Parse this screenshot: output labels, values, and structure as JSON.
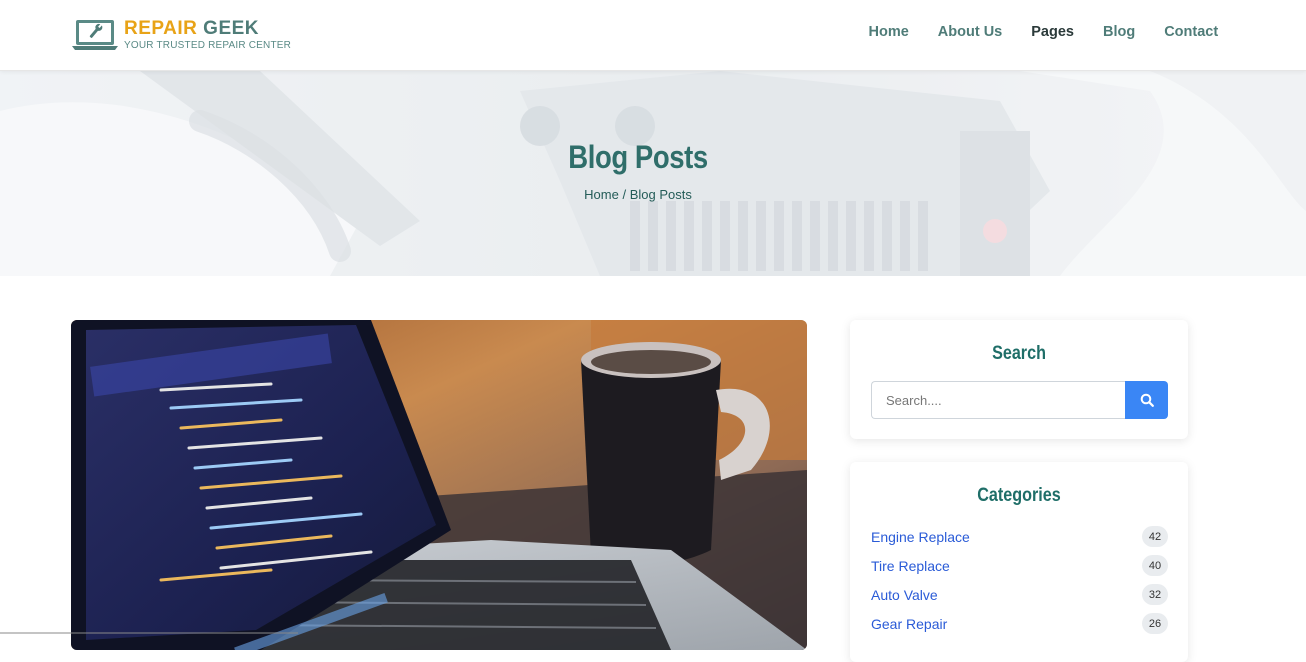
{
  "brand": {
    "name_part1": "REPAIR",
    "name_part2": "GEEK",
    "tagline": "YOUR TRUSTED REPAIR CENTER",
    "colors": {
      "accent": "#e8a317",
      "teal": "#4f7c78"
    }
  },
  "nav": {
    "items": [
      {
        "label": "Home"
      },
      {
        "label": "About Us"
      },
      {
        "label": "Pages",
        "active": true
      },
      {
        "label": "Blog"
      },
      {
        "label": "Contact"
      }
    ]
  },
  "hero": {
    "title": "Blog Posts",
    "breadcrumb_home": "Home",
    "breadcrumb_sep": " / ",
    "breadcrumb_current": "Blog Posts"
  },
  "post": {
    "image_icon": "laptop-code-photo"
  },
  "sidebar": {
    "search": {
      "title": "Search",
      "placeholder": "Search....",
      "value": "",
      "button_icon": "search-icon",
      "button_color": "#3a86f5"
    },
    "categories": {
      "title": "Categories",
      "items": [
        {
          "label": "Engine Replace",
          "count": "42"
        },
        {
          "label": "Tire Replace",
          "count": "40"
        },
        {
          "label": "Auto Valve",
          "count": "32"
        },
        {
          "label": "Gear Repair",
          "count": "26"
        }
      ]
    }
  }
}
